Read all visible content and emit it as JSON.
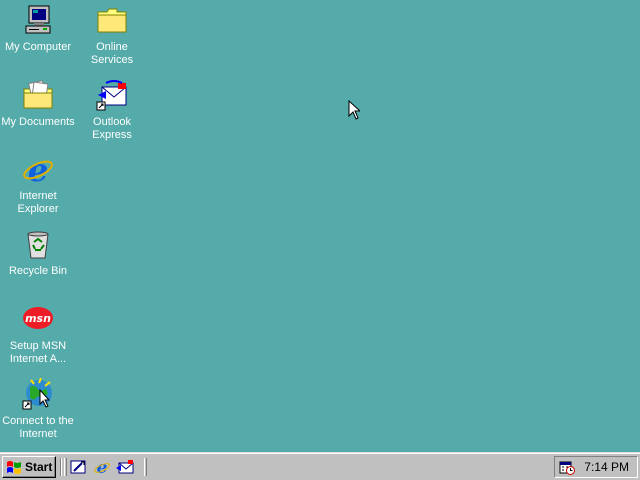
{
  "desktop": {
    "background": "#55aaaa",
    "icons": [
      {
        "label": "My Computer",
        "icon": "my-computer-icon"
      },
      {
        "label": "Online\nServices",
        "icon": "folder-icon"
      },
      {
        "label": "My Documents",
        "icon": "my-documents-icon"
      },
      {
        "label": "Outlook\nExpress",
        "icon": "outlook-express-icon"
      },
      {
        "label": "Internet\nExplorer",
        "icon": "internet-explorer-icon"
      },
      {
        "label": "Recycle Bin",
        "icon": "recycle-bin-icon"
      },
      {
        "label": "Setup MSN\nInternet A...",
        "icon": "msn-icon"
      },
      {
        "label": "Connect to the\nInternet",
        "icon": "connect-internet-icon"
      }
    ]
  },
  "taskbar": {
    "start_label": "Start",
    "quick_launch": [
      "show-desktop-icon",
      "internet-explorer-icon",
      "outlook-express-icon"
    ],
    "tray": {
      "clock": "7:14 PM",
      "icon": "task-scheduler-icon"
    }
  }
}
